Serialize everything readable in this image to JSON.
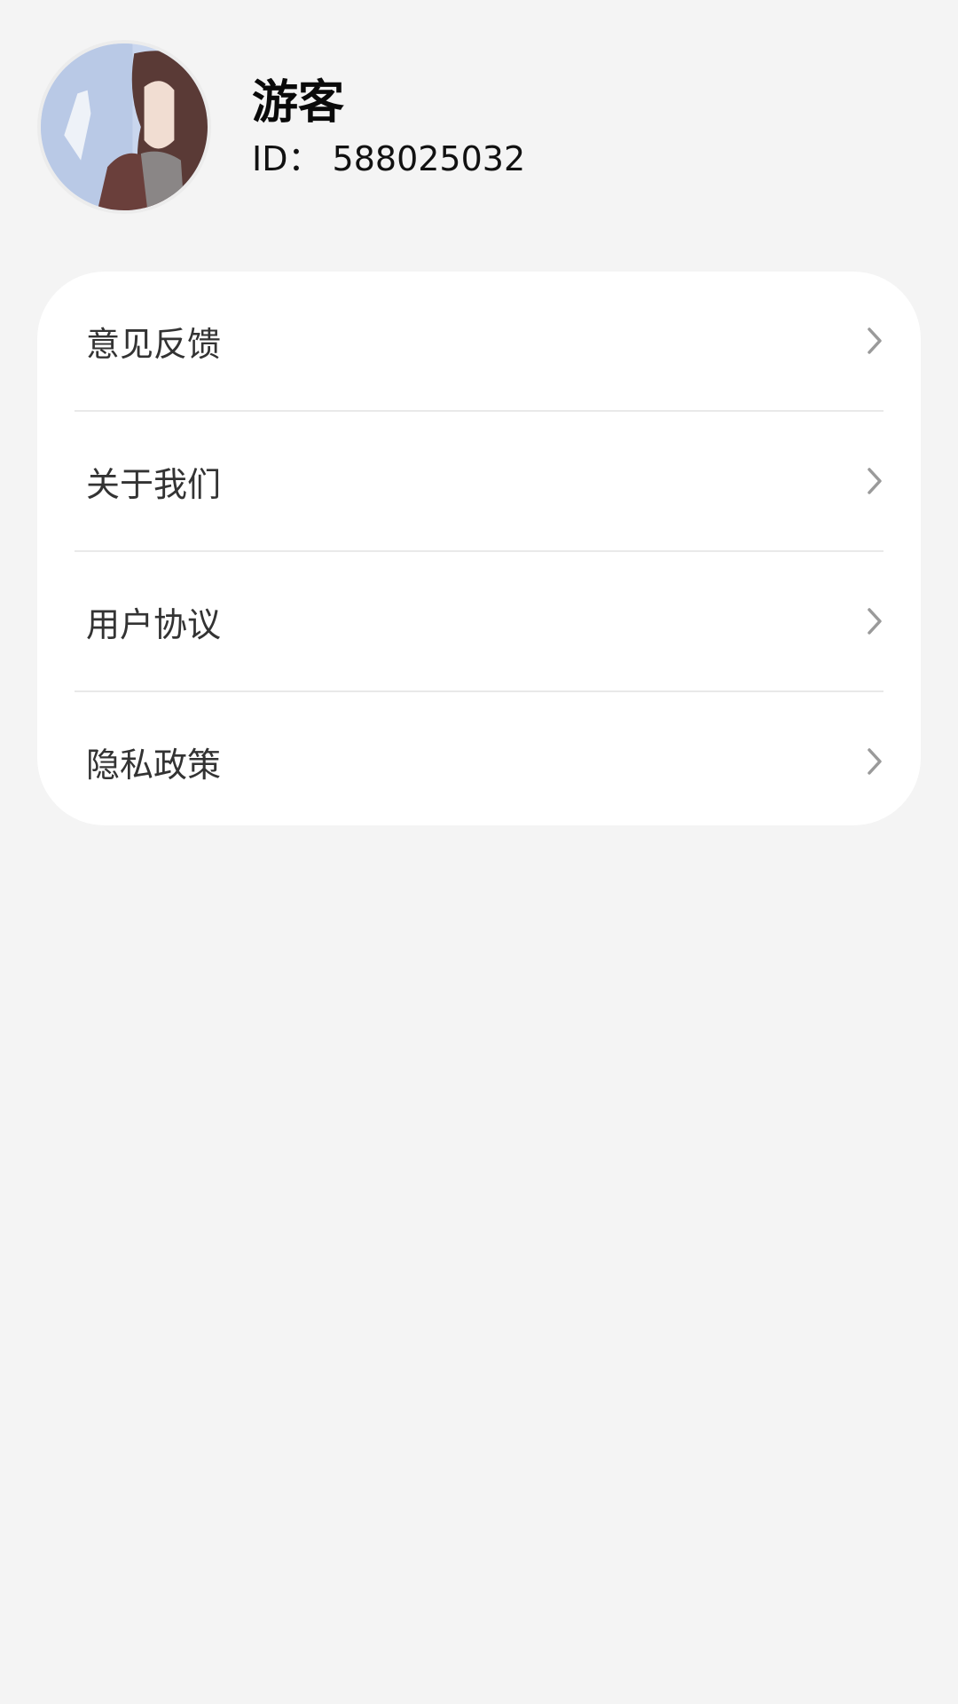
{
  "profile": {
    "name": "游客",
    "id_text": "ID：  588025032"
  },
  "menu": {
    "items": [
      {
        "label": "意见反馈",
        "icon": "chevron-right-icon"
      },
      {
        "label": "关于我们",
        "icon": "chevron-right-icon"
      },
      {
        "label": "用户协议",
        "icon": "chevron-right-icon"
      },
      {
        "label": "隐私政策",
        "icon": "chevron-right-icon"
      }
    ]
  },
  "colors": {
    "background": "#f4f4f4",
    "card": "#ffffff",
    "divider": "#e9e9e9",
    "chevron": "#9a9a9a",
    "label": "#333333"
  }
}
